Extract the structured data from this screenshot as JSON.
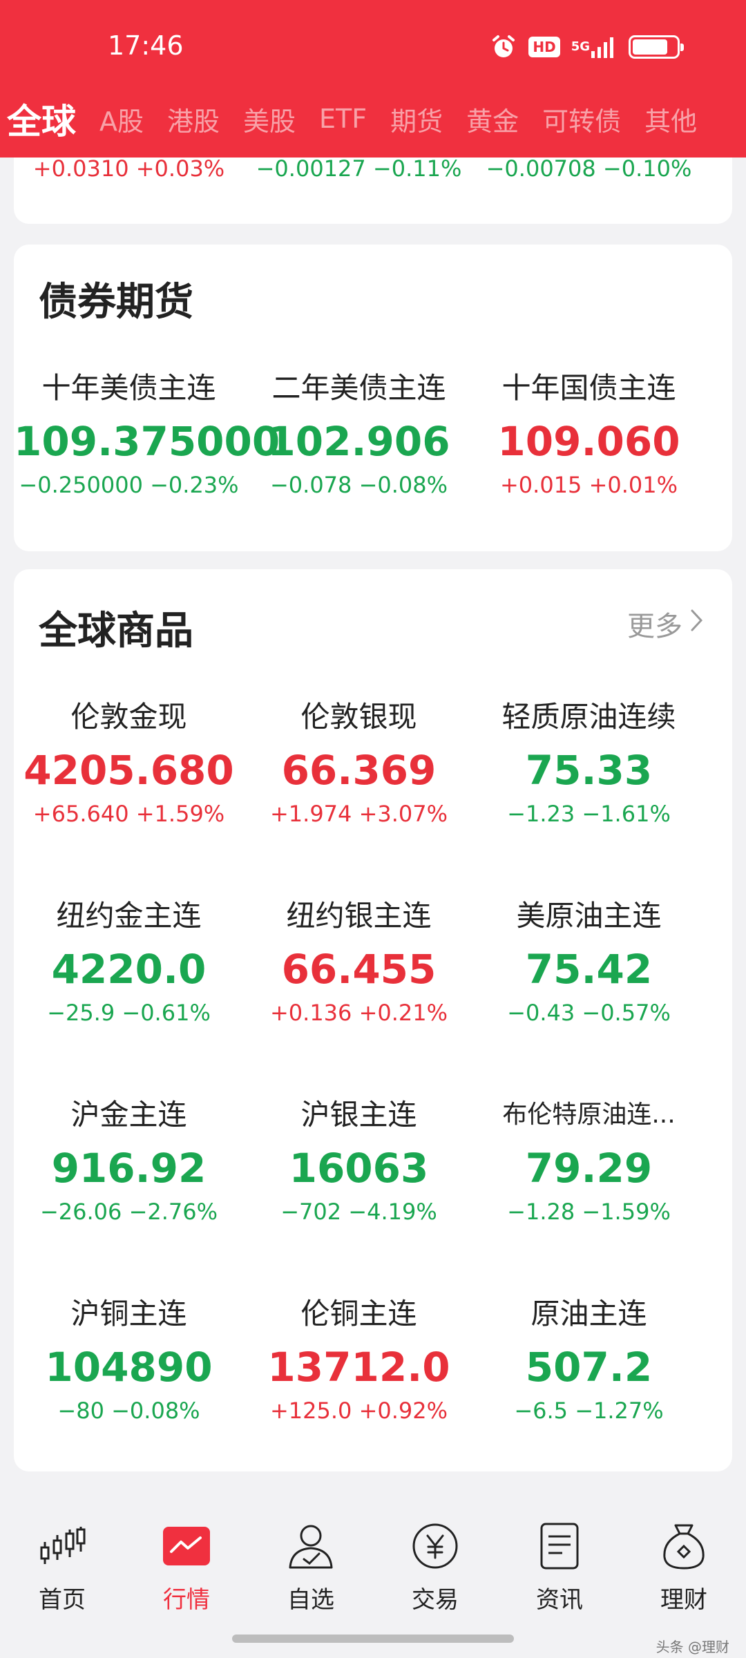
{
  "status": {
    "time": "17:46",
    "hd": "HD",
    "network": "5G",
    "battery_level": 0.8
  },
  "tabs": [
    "全球",
    "A股",
    "港股",
    "美股",
    "ETF",
    "期货",
    "黄金",
    "可转债",
    "其他"
  ],
  "top_row": [
    {
      "change": "+0.0310 +0.03%",
      "trend": "up"
    },
    {
      "change": "−0.00127 −0.11%",
      "trend": "down"
    },
    {
      "change": "−0.00708 −0.10%",
      "trend": "down"
    }
  ],
  "bonds": {
    "title": "债券期货",
    "items": [
      {
        "name": "十年美债主连",
        "price": "109.375000",
        "change": "−0.250000 −0.23%",
        "trend": "down"
      },
      {
        "name": "二年美债主连",
        "price": "102.906",
        "change": "−0.078 −0.08%",
        "trend": "down"
      },
      {
        "name": "十年国债主连",
        "price": "109.060",
        "change": "+0.015 +0.01%",
        "trend": "up"
      }
    ]
  },
  "commodities": {
    "title": "全球商品",
    "more": "更多",
    "rows": [
      [
        {
          "name": "伦敦金现",
          "price": "4205.680",
          "change": "+65.640 +1.59%",
          "trend": "up"
        },
        {
          "name": "伦敦银现",
          "price": "66.369",
          "change": "+1.974 +3.07%",
          "trend": "up"
        },
        {
          "name": "轻质原油连续",
          "price": "75.33",
          "change": "−1.23 −1.61%",
          "trend": "down"
        }
      ],
      [
        {
          "name": "纽约金主连",
          "price": "4220.0",
          "change": "−25.9 −0.61%",
          "trend": "down"
        },
        {
          "name": "纽约银主连",
          "price": "66.455",
          "change": "+0.136 +0.21%",
          "trend": "up"
        },
        {
          "name": "美原油主连",
          "price": "75.42",
          "change": "−0.43 −0.57%",
          "trend": "down"
        }
      ],
      [
        {
          "name": "沪金主连",
          "price": "916.92",
          "change": "−26.06 −2.76%",
          "trend": "down"
        },
        {
          "name": "沪银主连",
          "price": "16063",
          "change": "−702 −4.19%",
          "trend": "down"
        },
        {
          "name": "布伦特原油连...",
          "price": "79.29",
          "change": "−1.28 −1.59%",
          "trend": "down"
        }
      ],
      [
        {
          "name": "沪铜主连",
          "price": "104890",
          "change": "−80 −0.08%",
          "trend": "down"
        },
        {
          "name": "伦铜主连",
          "price": "13712.0",
          "change": "+125.0 +0.92%",
          "trend": "up"
        },
        {
          "name": "原油主连",
          "price": "507.2",
          "change": "−6.5 −1.27%",
          "trend": "down"
        }
      ]
    ]
  },
  "nav": [
    {
      "label": "首页",
      "icon": "candlestick-icon"
    },
    {
      "label": "行情",
      "icon": "market-chart-icon",
      "active": true
    },
    {
      "label": "自选",
      "icon": "user-check-icon"
    },
    {
      "label": "交易",
      "icon": "yuan-coin-icon"
    },
    {
      "label": "资讯",
      "icon": "news-doc-icon"
    },
    {
      "label": "理财",
      "icon": "money-bag-icon"
    }
  ],
  "watermark": "头条 @理财",
  "colors": {
    "brand_red": "#f0303f",
    "up": "#e8303a",
    "down": "#1aa650"
  }
}
